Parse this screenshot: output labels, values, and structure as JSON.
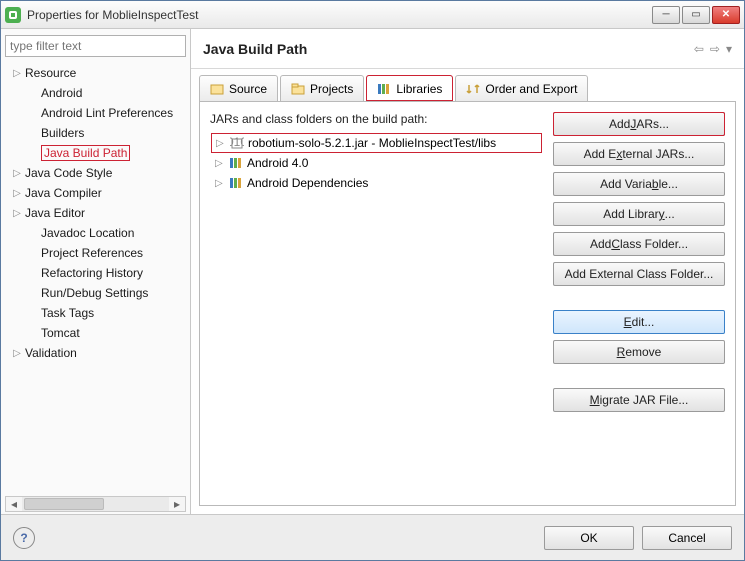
{
  "window": {
    "title": "Properties for MoblieInspectTest"
  },
  "filter_placeholder": "type filter text",
  "tree": [
    {
      "label": "Resource",
      "expandable": true
    },
    {
      "label": "Android",
      "expandable": false,
      "child": true
    },
    {
      "label": "Android Lint Preferences",
      "expandable": false,
      "child": true
    },
    {
      "label": "Builders",
      "expandable": false,
      "child": true
    },
    {
      "label": "Java Build Path",
      "expandable": false,
      "child": true,
      "selected": true
    },
    {
      "label": "Java Code Style",
      "expandable": true
    },
    {
      "label": "Java Compiler",
      "expandable": true
    },
    {
      "label": "Java Editor",
      "expandable": true
    },
    {
      "label": "Javadoc Location",
      "expandable": false,
      "child": true
    },
    {
      "label": "Project References",
      "expandable": false,
      "child": true
    },
    {
      "label": "Refactoring History",
      "expandable": false,
      "child": true
    },
    {
      "label": "Run/Debug Settings",
      "expandable": false,
      "child": true
    },
    {
      "label": "Task Tags",
      "expandable": false,
      "child": true
    },
    {
      "label": "Tomcat",
      "expandable": false,
      "child": true
    },
    {
      "label": "Validation",
      "expandable": true
    }
  ],
  "banner": {
    "title": "Java Build Path"
  },
  "tabs": [
    {
      "label": "Source",
      "icon": "source"
    },
    {
      "label": "Projects",
      "icon": "projects"
    },
    {
      "label": "Libraries",
      "icon": "libraries",
      "active": true,
      "highlight": true
    },
    {
      "label": "Order and Export",
      "icon": "order"
    }
  ],
  "list_label": "JARs and class folders on the build path:",
  "jars": [
    {
      "label": "robotium-solo-5.2.1.jar - MoblieInspectTest/libs",
      "icon": "jar",
      "highlight": true
    },
    {
      "label": "Android 4.0",
      "icon": "lib"
    },
    {
      "label": "Android Dependencies",
      "icon": "lib"
    }
  ],
  "buttons": {
    "addJars": "Add JARs...",
    "addExtJars": "Add External JARs...",
    "addVar": "Add Variable...",
    "addLib": "Add Library...",
    "addClassFolder": "Add Class Folder...",
    "addExtClassFolder": "Add External Class Folder...",
    "edit": "Edit...",
    "remove": "Remove",
    "migrate": "Migrate JAR File..."
  },
  "footer": {
    "ok": "OK",
    "cancel": "Cancel"
  }
}
